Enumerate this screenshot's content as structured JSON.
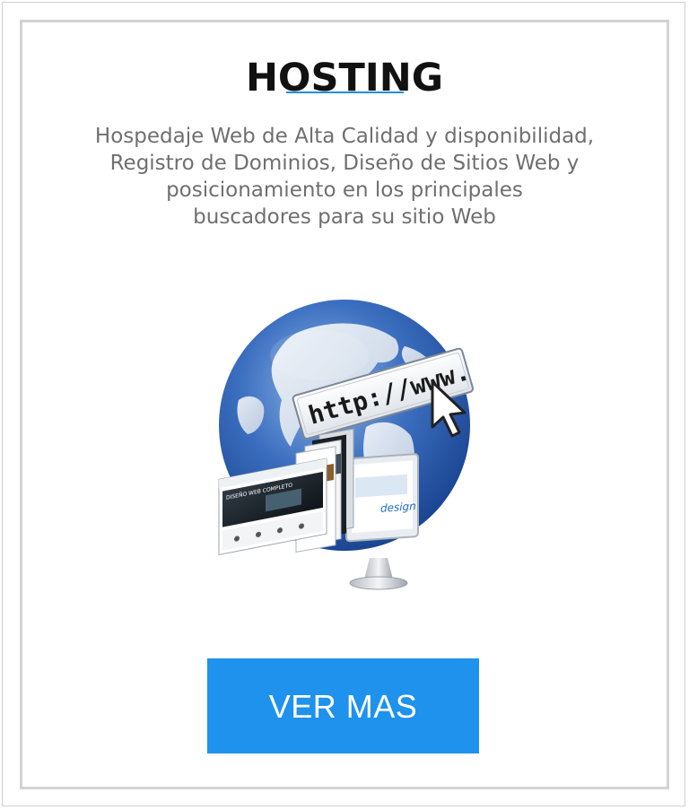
{
  "card": {
    "title": "HOSTING",
    "description_lines": [
      "Hospedaje Web de Alta Calidad y disponibilidad,",
      "Registro de Dominios, Diseño de Sitios Web y",
      "posicionamiento en los principales",
      "buscadores para su sitio Web"
    ],
    "illustration": {
      "url_text": "http://www.",
      "screen_headline": "DISEÑO WEB COMPLETO",
      "screen_word": "design",
      "icons": [
        "globe-icon",
        "cursor-arrow-icon",
        "monitor-icon"
      ]
    },
    "cta_label": "VER MAS"
  },
  "colors": {
    "accent": "#1e92ec",
    "title": "#111111",
    "text": "#6f6f6f",
    "border": "#d3d3d3"
  }
}
